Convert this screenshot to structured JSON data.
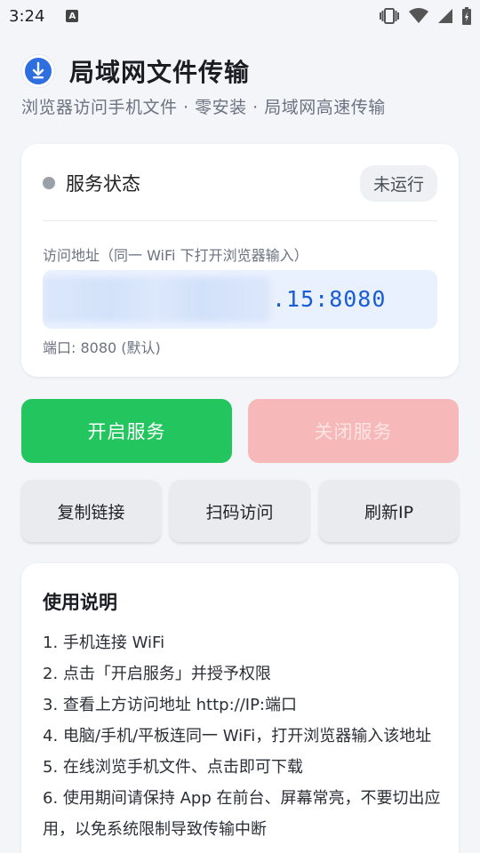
{
  "status_bar": {
    "time": "3:24",
    "notification_icon": "A",
    "icons": [
      "vibrate-icon",
      "wifi-icon",
      "cell-signal-icon",
      "battery-icon"
    ]
  },
  "header": {
    "title": "局域网文件传输",
    "subtitle": "浏览器访问手机文件 · 零安装 · 局域网高速传输"
  },
  "service": {
    "label": "服务状态",
    "badge": "未运行",
    "address_label": "访问地址（同一 WiFi 下打开浏览器输入）",
    "address_visible": ".15:8080",
    "port": "端口: 8080 (默认)"
  },
  "actions": {
    "start": "开启服务",
    "stop": "关闭服务",
    "copy": "复制链接",
    "scan": "扫码访问",
    "refresh": "刷新IP"
  },
  "guide": {
    "title": "使用说明",
    "items": [
      "1. 手机连接 WiFi",
      "2. 点击「开启服务」并授予权限",
      "3. 查看上方访问地址 http://IP:端口",
      "4. 电脑/手机/平板连同一 WiFi，打开浏览器输入该地址",
      "5. 在线浏览手机文件、点击即可下载",
      "6. 使用期间请保持 App 在前台、屏幕常亮，不要切出应用，以免系统限制导致传输中断"
    ]
  },
  "colors": {
    "start_button": "#22c55e",
    "stop_button_disabled": "#f6b8b8",
    "address_text": "#1a5cd6",
    "status_dot_idle": "#9aa0a8"
  }
}
